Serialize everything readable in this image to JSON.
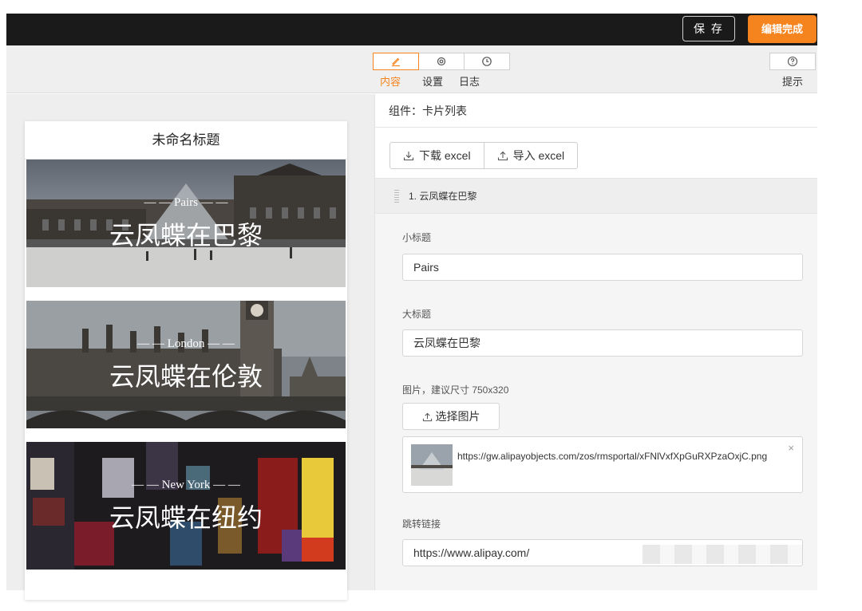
{
  "header": {
    "save_label": "保 存",
    "done_label": "编辑完成"
  },
  "toolbar": {
    "tabs": [
      {
        "label": "内容",
        "icon": "edit-icon",
        "active": true
      },
      {
        "label": "设置",
        "icon": "settings-icon",
        "active": false
      },
      {
        "label": "日志",
        "icon": "clock-icon",
        "active": false
      }
    ],
    "hint_label": "提示",
    "hint_icon": "help-icon",
    "accent": "#f5841f"
  },
  "preview": {
    "page_title": "未命名标题",
    "cards": [
      {
        "subtitle": "— — Pairs — —",
        "title": "云凤蝶在巴黎"
      },
      {
        "subtitle": "— — London — —",
        "title": "云凤蝶在伦敦"
      },
      {
        "subtitle": "— — New York — —",
        "title": "云凤蝶在纽约"
      }
    ]
  },
  "editor": {
    "component_label": "组件：卡片列表",
    "download_label": "下载 excel",
    "import_label": "导入 excel",
    "item_title": "1.  云凤蝶在巴黎",
    "subtitle_label": "小标题",
    "subtitle_value": "Pairs",
    "title_label": "大标题",
    "title_value": "云凤蝶在巴黎",
    "image_label": "图片，建议尺寸 750x320",
    "choose_image_label": "选择图片",
    "image_url": "https://gw.alipayobjects.com/zos/rmsportal/xFNlVxfXpGuRXPzaOxjC.png",
    "close_symbol": "×",
    "link_label": "跳转链接",
    "link_value": "https://www.alipay.com/"
  }
}
